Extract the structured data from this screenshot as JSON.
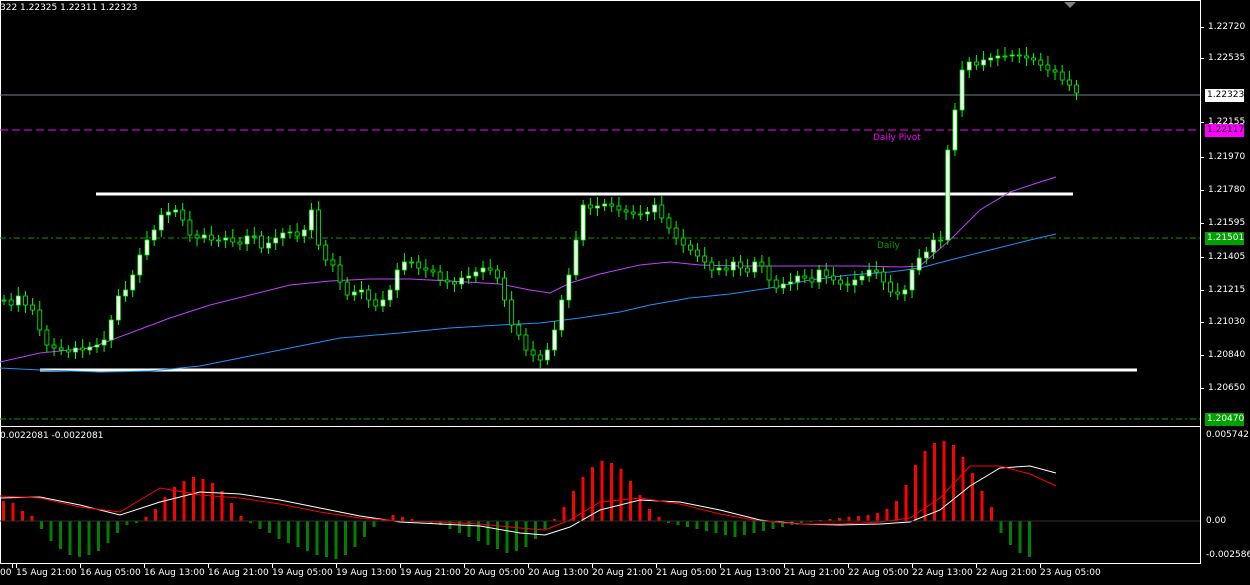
{
  "header": {
    "ohlc_text": "322 1.22325 1.22311 1.22323"
  },
  "price_axis": {
    "ticks": [
      "1.22720",
      "1.22535",
      "1.22155",
      "1.21970",
      "1.21780",
      "1.21595",
      "1.21405",
      "1.21215",
      "1.21030",
      "1.20840",
      "1.20650"
    ],
    "current_price_tag": "1.22323",
    "pivot_tag": "1.22117",
    "level_green_tag": "1.21501",
    "level_bottom_tag": "1.20470"
  },
  "labels": {
    "daily_pivot": "Daily Pivot",
    "daily_s1_partial": "Daily"
  },
  "indicator": {
    "header_text": "0.0022081 -0.0022081",
    "axis_ticks": [
      "0.0057421",
      "0.00",
      "-0.002586"
    ]
  },
  "time_axis": {
    "labels": [
      "00",
      "15 Aug 21:00",
      "16 Aug 05:00",
      "16 Aug 13:00",
      "16 Aug 21:00",
      "19 Aug 05:00",
      "19 Aug 13:00",
      "19 Aug 21:00",
      "20 Aug 05:00",
      "20 Aug 13:00",
      "20 Aug 21:00",
      "21 Aug 05:00",
      "21 Aug 13:00",
      "21 Aug 21:00",
      "22 Aug 05:00",
      "22 Aug 13:00",
      "22 Aug 21:00",
      "23 Aug 05:00"
    ]
  },
  "colors": {
    "background": "#000000",
    "bull_candle": "#ffffff",
    "bear_candle": "#000000",
    "wick": "#00ff00",
    "pivot_line": "#ff00ff",
    "green_dash": "#00a000",
    "bid_line": "#708090",
    "ma_fast": "#c040ff",
    "ma_slow": "#1e90ff",
    "hist_up": "#ff0000",
    "hist_down": "#008000",
    "signal_white": "#ffffff",
    "signal_red": "#ff0000"
  }
}
